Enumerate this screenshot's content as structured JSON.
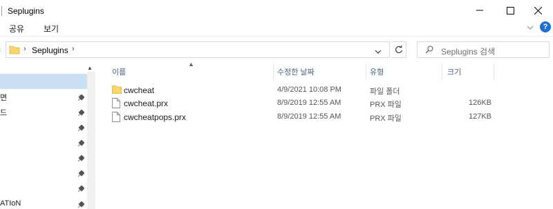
{
  "window": {
    "title": "Seplugins",
    "controls": {
      "minimize": "minimize",
      "maximize": "maximize",
      "close": "close"
    }
  },
  "ribbon": {
    "tabs": [
      {
        "label": "공유"
      },
      {
        "label": "보기"
      }
    ],
    "help_label": "?"
  },
  "address": {
    "path": [
      "Seplugins"
    ],
    "search_placeholder": "Seplugins 검색"
  },
  "nav_pane": {
    "items": [
      {
        "label": "",
        "pinned": false,
        "selected": true
      },
      {
        "label": "면",
        "pinned": true
      },
      {
        "label": "드",
        "pinned": true
      },
      {
        "label": "",
        "pinned": true
      },
      {
        "label": "",
        "pinned": true
      },
      {
        "label": "",
        "pinned": true
      },
      {
        "label": "",
        "pinned": true
      },
      {
        "label": "",
        "pinned": true
      },
      {
        "label": "ATIoN",
        "pinned": true
      }
    ]
  },
  "columns": {
    "name": "이름",
    "date": "수정한 날짜",
    "type": "유형",
    "size": "크기"
  },
  "files": [
    {
      "name": "cwcheat",
      "date": "4/9/2021 10:08 PM",
      "type": "파일 폴더",
      "size": "",
      "icon": "folder-icon"
    },
    {
      "name": "cwcheat.prx",
      "date": "8/9/2019 12:55 AM",
      "type": "PRX 파일",
      "size": "126KB",
      "icon": "file-icon"
    },
    {
      "name": "cwcheatpops.prx",
      "date": "8/9/2019 12:55 AM",
      "type": "PRX 파일",
      "size": "127KB",
      "icon": "file-icon"
    }
  ],
  "colors": {
    "selection": "#cce0f5",
    "folder": "#f7d56b",
    "help_accent": "#1e6fd0",
    "header_text": "#4c607a"
  }
}
